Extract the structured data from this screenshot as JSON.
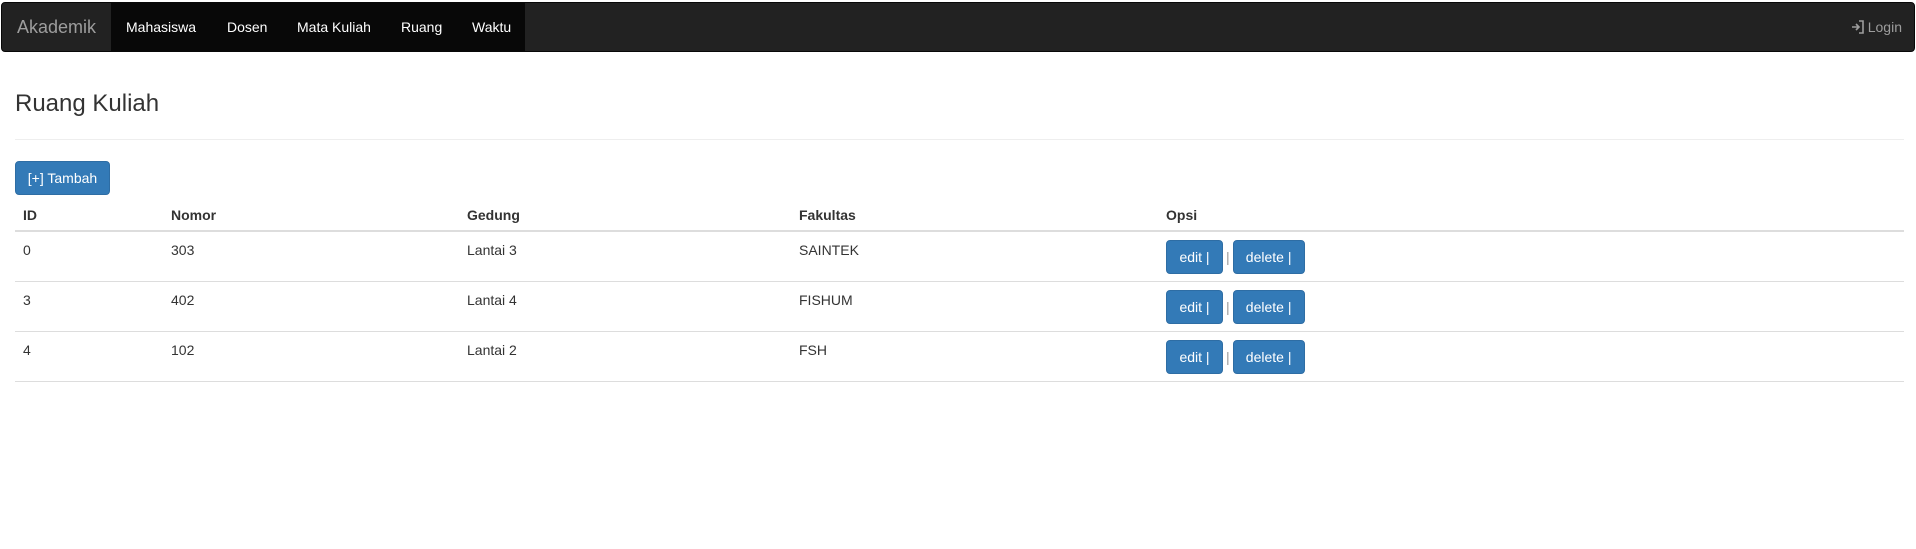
{
  "navbar": {
    "brand": "Akademik",
    "items": [
      {
        "label": "Mahasiswa"
      },
      {
        "label": "Dosen"
      },
      {
        "label": "Mata Kuliah"
      },
      {
        "label": "Ruang"
      },
      {
        "label": "Waktu"
      }
    ],
    "login_label": "Login",
    "login_icon": "login-icon"
  },
  "page": {
    "title": "Ruang Kuliah",
    "add_button": "[+] Tambah"
  },
  "table": {
    "headers": [
      "ID",
      "Nomor",
      "Gedung",
      "Fakultas",
      "Opsi"
    ],
    "rows": [
      {
        "id": "0",
        "nomor": "303",
        "gedung": "Lantai 3",
        "fakultas": "SAINTEK",
        "edit": "edit |",
        "sep": "|",
        "delete": "delete |"
      },
      {
        "id": "3",
        "nomor": "402",
        "gedung": "Lantai 4",
        "fakultas": "FISHUM",
        "edit": "edit |",
        "sep": "|",
        "delete": "delete |"
      },
      {
        "id": "4",
        "nomor": "102",
        "gedung": "Lantai 2",
        "fakultas": "FSH",
        "edit": "edit |",
        "sep": "|",
        "delete": "delete |"
      }
    ]
  },
  "colors": {
    "navbar_bg": "#222222",
    "navbar_active_bg": "#080808",
    "primary": "#337ab7"
  }
}
